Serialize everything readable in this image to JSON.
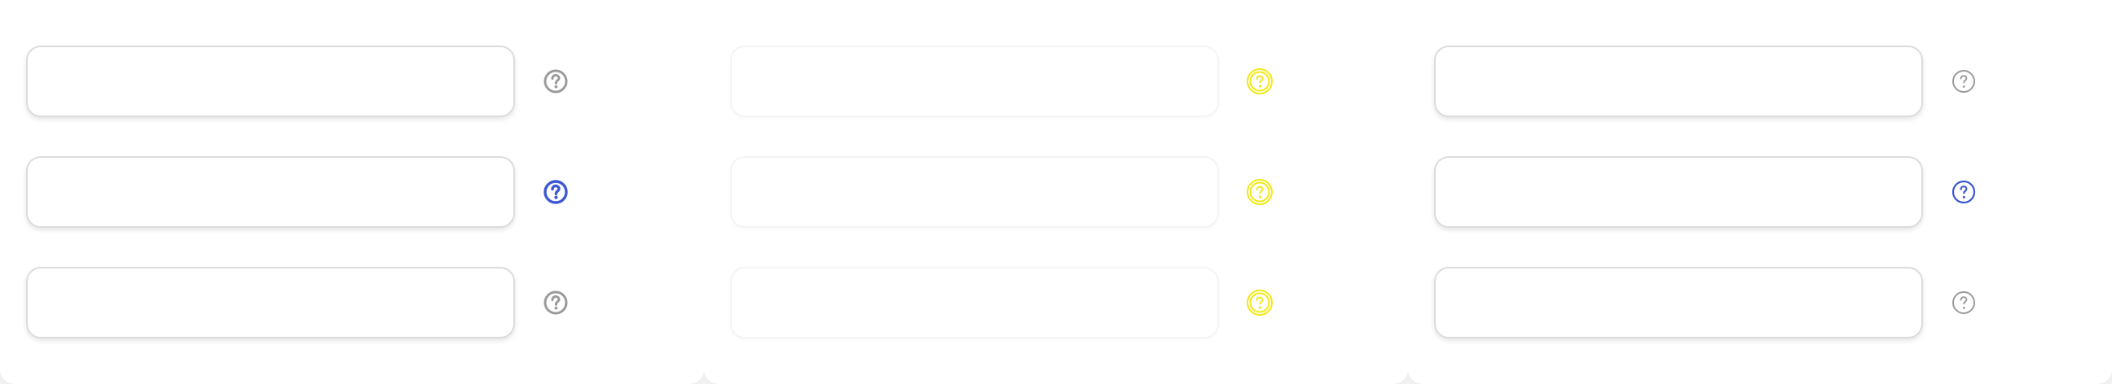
{
  "colors": {
    "background": "#eef0f2",
    "panel": "#ffffff",
    "field_border": "#dcdcdc",
    "help_default": "#9b9b9b",
    "help_active": "#3c58d2",
    "help_highlight": "#f1e91a"
  },
  "panels": [
    {
      "fields": [
        {
          "value": "",
          "placeholder": "",
          "help_icon": "question-circle-icon",
          "state": "default"
        },
        {
          "value": "",
          "placeholder": "",
          "help_icon": "question-circle-icon",
          "state": "active"
        },
        {
          "value": "",
          "placeholder": "",
          "help_icon": "question-circle-icon",
          "state": "default"
        }
      ]
    },
    {
      "fields": [
        {
          "value": "",
          "placeholder": "",
          "help_icon": "question-circle-icon",
          "state": "highlight"
        },
        {
          "value": "",
          "placeholder": "",
          "help_icon": "question-circle-icon",
          "state": "highlight"
        },
        {
          "value": "",
          "placeholder": "",
          "help_icon": "question-circle-icon",
          "state": "highlight"
        }
      ]
    },
    {
      "fields": [
        {
          "value": "",
          "placeholder": "",
          "help_icon": "question-circle-icon",
          "state": "default"
        },
        {
          "value": "",
          "placeholder": "",
          "help_icon": "question-circle-icon",
          "state": "active"
        },
        {
          "value": "",
          "placeholder": "",
          "help_icon": "question-circle-icon",
          "state": "default"
        }
      ]
    }
  ]
}
